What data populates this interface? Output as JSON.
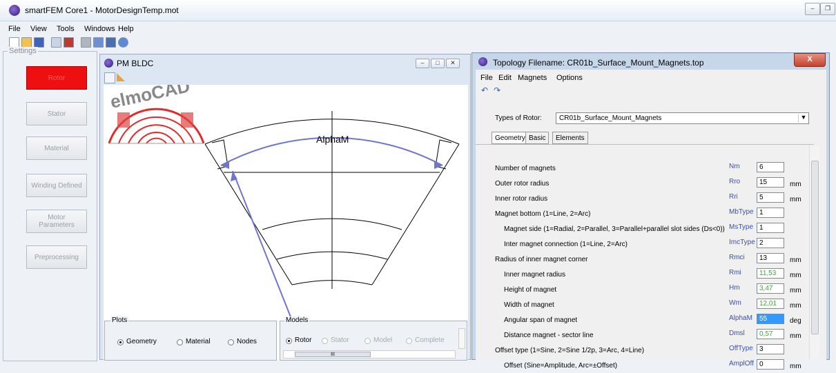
{
  "app": {
    "title": "smartFEM Core1  -  MotorDesignTemp.mot"
  },
  "menu": [
    "File",
    "View",
    "Tools",
    "Windows",
    "Help"
  ],
  "settings": {
    "legend": "Settings",
    "buttons": [
      "Rotor",
      "Stator",
      "Material",
      "Winding Defined",
      "Motor\nParameters",
      "Preprocessing"
    ]
  },
  "pm_window": {
    "title": "PM BLDC",
    "logo": "elmoCAD",
    "diagram_label": "AlphaM",
    "plots": {
      "legend": "Plots",
      "options": [
        "Geometry",
        "Material",
        "Nodes"
      ],
      "selected": "Geometry"
    },
    "models": {
      "legend": "Models",
      "options": [
        "Rotor",
        "Stator",
        "Model",
        "Complete"
      ],
      "selected": "Rotor",
      "scroll_glyph": "III"
    }
  },
  "topology_window": {
    "title": "Topology Filename: CR01b_Surface_Mount_Magnets.top",
    "close": "X",
    "menu": [
      "File",
      "Edit",
      "Magnets",
      "Options"
    ],
    "rotor_type_label": "Types of Rotor:",
    "rotor_type_value": "CR01b_Surface_Mount_Magnets",
    "tabs": [
      "Geometry",
      "Basic",
      "Elements"
    ],
    "params": [
      {
        "label": "Number of magnets",
        "sym": "Nm",
        "value": "6",
        "unit": "",
        "indent": false,
        "calc": false,
        "sel": false
      },
      {
        "label": "Outer rotor radius",
        "sym": "Rro",
        "value": "15",
        "unit": "mm",
        "indent": false,
        "calc": false,
        "sel": false
      },
      {
        "label": "Inner rotor radius",
        "sym": "Rri",
        "value": "5",
        "unit": "mm",
        "indent": false,
        "calc": false,
        "sel": false
      },
      {
        "label": "Magnet bottom (1=Line, 2=Arc)",
        "sym": "MbType",
        "value": "1",
        "unit": "",
        "indent": false,
        "calc": false,
        "sel": false
      },
      {
        "label": "Magnet side (1=Radial, 2=Parallel, 3=Parallel+parallel slot sides (Ds<0))",
        "sym": "MsType",
        "value": "1",
        "unit": "",
        "indent": true,
        "calc": false,
        "sel": false
      },
      {
        "label": "Inter magnet connection (1=Line, 2=Arc)",
        "sym": "ImcType",
        "value": "2",
        "unit": "",
        "indent": true,
        "calc": false,
        "sel": false
      },
      {
        "label": "Radius of inner magnet corner",
        "sym": "Rmci",
        "value": "13",
        "unit": "mm",
        "indent": false,
        "calc": false,
        "sel": false
      },
      {
        "label": "Inner magnet radius",
        "sym": "Rmi",
        "value": "11,53",
        "unit": "mm",
        "indent": true,
        "calc": true,
        "sel": false
      },
      {
        "label": "Height of magnet",
        "sym": "Hm",
        "value": "3,47",
        "unit": "mm",
        "indent": true,
        "calc": true,
        "sel": false
      },
      {
        "label": "Width of magnet",
        "sym": "Wm",
        "value": "12,01",
        "unit": "mm",
        "indent": true,
        "calc": true,
        "sel": false
      },
      {
        "label": "Angular span of magnet",
        "sym": "AlphaM",
        "value": "55",
        "unit": "deg",
        "indent": true,
        "calc": false,
        "sel": true
      },
      {
        "label": "Distance magnet - sector line",
        "sym": "Dmsl",
        "value": "0,57",
        "unit": "mm",
        "indent": true,
        "calc": true,
        "sel": false
      },
      {
        "label": "Offset type (1=Sine, 2=Sine 1/2p, 3=Arc, 4=Line)",
        "sym": "OffType",
        "value": "3",
        "unit": "",
        "indent": false,
        "calc": false,
        "sel": false
      },
      {
        "label": "Offset (Sine=Amplitude, Arc=±Offset)",
        "sym": "AmplOff",
        "value": "0",
        "unit": "mm",
        "indent": true,
        "calc": false,
        "sel": false
      }
    ]
  },
  "colors": {
    "active_button": "#ee1010",
    "calc_value": "#49a049",
    "symbol": "#3a4fb5",
    "arrow": "#6f74cc"
  }
}
